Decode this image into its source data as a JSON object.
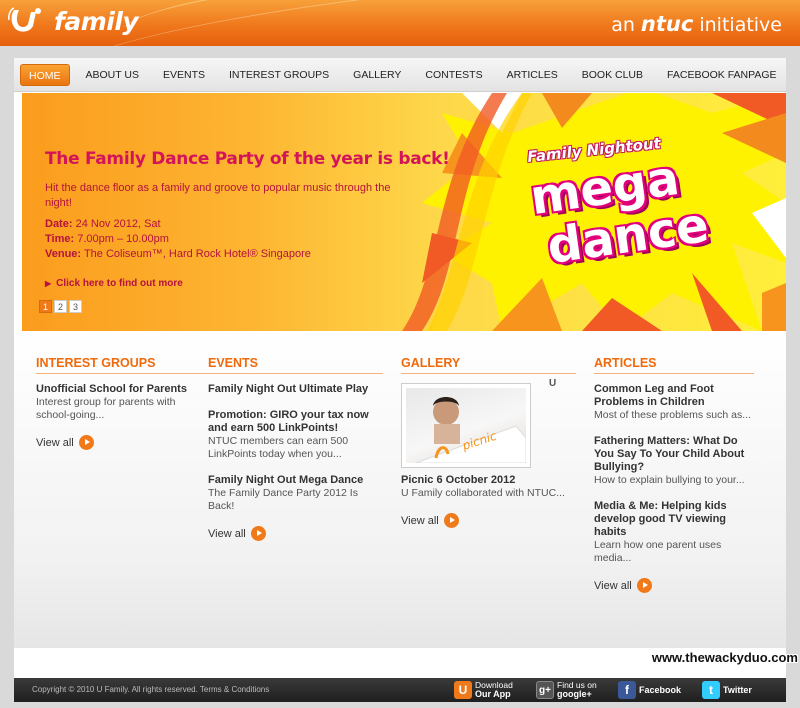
{
  "header": {
    "logo_text": "family",
    "ntuc_prefix": "an",
    "ntuc_brand": "ntuc",
    "ntuc_suffix": "initiative"
  },
  "nav": {
    "items": [
      "HOME",
      "ABOUT US",
      "EVENTS",
      "INTEREST GROUPS",
      "GALLERY",
      "CONTESTS",
      "ARTICLES",
      "BOOK CLUB",
      "FACEBOOK FANPAGE"
    ],
    "active": "HOME"
  },
  "banner": {
    "title": "The Family Dance Party of the year is back!",
    "desc": "Hit the dance floor as a family and groove to popular music through the night!",
    "date_label": "Date:",
    "date_value": "24 Nov 2012, Sat",
    "time_label": "Time:",
    "time_value": "7.00pm – 10.00pm",
    "venue_label": "Venue:",
    "venue_value": "The Coliseum™, Hard Rock Hotel® Singapore",
    "more_link": "Click here to find out more",
    "pages": [
      "1",
      "2",
      "3"
    ],
    "art_small": "Family Nightout",
    "art_line1": "mega",
    "art_line2": "dance"
  },
  "interest_groups": {
    "heading": "INTEREST GROUPS",
    "items": [
      {
        "title": "Unofficial School for Parents",
        "text": "Interest group for parents with school-going..."
      }
    ],
    "view_all": "View all"
  },
  "events": {
    "heading": "EVENTS",
    "items": [
      {
        "title": "Family Night Out Ultimate Play",
        "text": ""
      },
      {
        "title": "Promotion: GIRO your tax now and earn 500 LinkPoints!",
        "text": "NTUC members can earn 500 LinkPoints today when you..."
      },
      {
        "title": "Family Night Out Mega Dance",
        "text": "The Family Dance Party 2012 Is Back!"
      }
    ],
    "view_all": "View all"
  },
  "gallery": {
    "heading": "GALLERY",
    "thumb_caption": "U",
    "title": "Picnic 6 October 2012",
    "text": "U Family collaborated with NTUC...",
    "photo_sign": "picnic",
    "view_all": "View all"
  },
  "articles": {
    "heading": "ARTICLES",
    "items": [
      {
        "title": "Common Leg and Foot Problems in Children",
        "text": "Most of these problems such as..."
      },
      {
        "title": "Fathering Matters: What Do You Say To Your Child About Bullying?",
        "text": "How to explain bullying to your..."
      },
      {
        "title": "Media & Me: Helping kids develop good TV viewing habits",
        "text": "Learn how one parent uses media..."
      }
    ],
    "view_all": "View all"
  },
  "footer": {
    "copyright": "Copyright © 2010 U Family. All rights reserved.",
    "terms": "Terms & Conditions",
    "app_line1": "Download",
    "app_line2": "Our App",
    "google_line1": "Find us on",
    "google_line2": "google+",
    "facebook": "Facebook",
    "twitter": "Twitter"
  },
  "watermark": "www.thewackyduo.com",
  "colors": {
    "accent": "#f06a0c",
    "banner_text": "#b5123e",
    "title_pink": "#d4145a"
  }
}
